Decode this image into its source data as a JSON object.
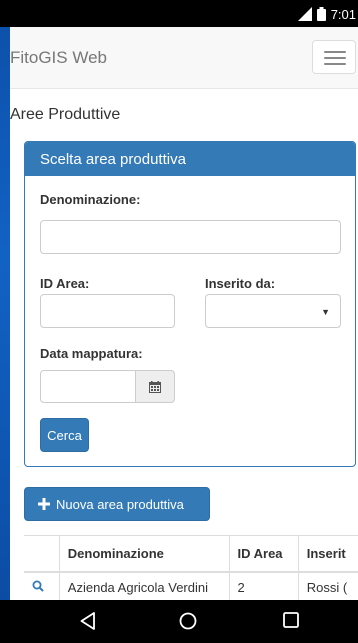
{
  "status": {
    "time": "7:01"
  },
  "navbar": {
    "brand": "FitoGIS Web"
  },
  "page": {
    "title": "Aree Produttive"
  },
  "panel": {
    "heading": "Scelta area produttiva",
    "denominazione_label": "Denominazione:",
    "denominazione_value": "",
    "id_area_label": "ID Area:",
    "id_area_value": "",
    "inserito_da_label": "Inserito da:",
    "inserito_da_selected": "",
    "data_mappatura_label": "Data mappatura:",
    "data_mappatura_value": "",
    "search_button": "Cerca"
  },
  "new_button": "Nuova area produttiva",
  "table": {
    "headers": [
      "",
      "Denominazione",
      "ID Area",
      "Inserit"
    ],
    "rows": [
      {
        "action_icon": "search-icon",
        "denominazione": "Azienda Agricola Verdini",
        "id_area": "2",
        "inserito_da": "Rossi ("
      }
    ]
  },
  "icons": {
    "calendar": "calendar-icon",
    "menu": "hamburger-icon",
    "plus": "plus-icon",
    "back": "back-triangle-icon",
    "home": "home-circle-icon",
    "recents": "recents-square-icon"
  },
  "colors": {
    "primary": "#337ab7",
    "background": "#0d4fa8"
  }
}
